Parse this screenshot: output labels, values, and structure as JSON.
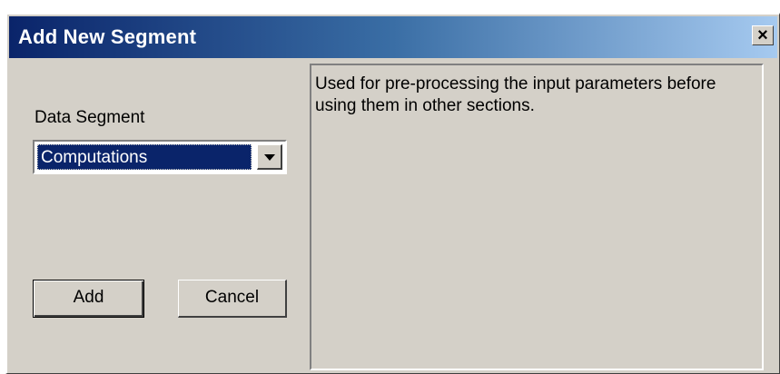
{
  "window": {
    "title": "Add New Segment",
    "close_glyph": "×",
    "title_gradient": [
      "#0a246a",
      "#a6caf0"
    ],
    "background": "#d4d0c8"
  },
  "form": {
    "data_segment_label": "Data Segment",
    "data_segment_value": "Computations",
    "dropdown_icon": "chevron-down-icon"
  },
  "description": {
    "text": "Used for pre-processing the input parameters before using them in other sections."
  },
  "buttons": {
    "add_label": "Add",
    "cancel_label": "Cancel"
  }
}
